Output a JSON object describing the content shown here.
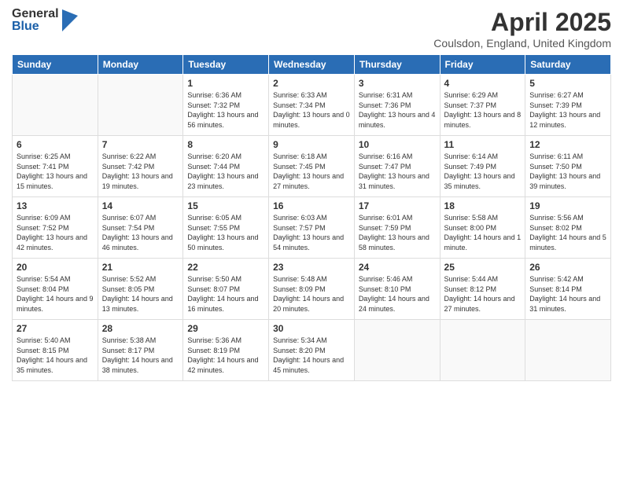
{
  "logo": {
    "general": "General",
    "blue": "Blue"
  },
  "title": "April 2025",
  "subtitle": "Coulsdon, England, United Kingdom",
  "headers": [
    "Sunday",
    "Monday",
    "Tuesday",
    "Wednesday",
    "Thursday",
    "Friday",
    "Saturday"
  ],
  "weeks": [
    [
      {
        "day": "",
        "sunrise": "",
        "sunset": "",
        "daylight": "",
        "empty": true
      },
      {
        "day": "",
        "sunrise": "",
        "sunset": "",
        "daylight": "",
        "empty": true
      },
      {
        "day": "1",
        "sunrise": "Sunrise: 6:36 AM",
        "sunset": "Sunset: 7:32 PM",
        "daylight": "Daylight: 13 hours and 56 minutes.",
        "empty": false
      },
      {
        "day": "2",
        "sunrise": "Sunrise: 6:33 AM",
        "sunset": "Sunset: 7:34 PM",
        "daylight": "Daylight: 13 hours and 0 minutes.",
        "empty": false
      },
      {
        "day": "3",
        "sunrise": "Sunrise: 6:31 AM",
        "sunset": "Sunset: 7:36 PM",
        "daylight": "Daylight: 13 hours and 4 minutes.",
        "empty": false
      },
      {
        "day": "4",
        "sunrise": "Sunrise: 6:29 AM",
        "sunset": "Sunset: 7:37 PM",
        "daylight": "Daylight: 13 hours and 8 minutes.",
        "empty": false
      },
      {
        "day": "5",
        "sunrise": "Sunrise: 6:27 AM",
        "sunset": "Sunset: 7:39 PM",
        "daylight": "Daylight: 13 hours and 12 minutes.",
        "empty": false
      }
    ],
    [
      {
        "day": "6",
        "sunrise": "Sunrise: 6:25 AM",
        "sunset": "Sunset: 7:41 PM",
        "daylight": "Daylight: 13 hours and 15 minutes.",
        "empty": false
      },
      {
        "day": "7",
        "sunrise": "Sunrise: 6:22 AM",
        "sunset": "Sunset: 7:42 PM",
        "daylight": "Daylight: 13 hours and 19 minutes.",
        "empty": false
      },
      {
        "day": "8",
        "sunrise": "Sunrise: 6:20 AM",
        "sunset": "Sunset: 7:44 PM",
        "daylight": "Daylight: 13 hours and 23 minutes.",
        "empty": false
      },
      {
        "day": "9",
        "sunrise": "Sunrise: 6:18 AM",
        "sunset": "Sunset: 7:45 PM",
        "daylight": "Daylight: 13 hours and 27 minutes.",
        "empty": false
      },
      {
        "day": "10",
        "sunrise": "Sunrise: 6:16 AM",
        "sunset": "Sunset: 7:47 PM",
        "daylight": "Daylight: 13 hours and 31 minutes.",
        "empty": false
      },
      {
        "day": "11",
        "sunrise": "Sunrise: 6:14 AM",
        "sunset": "Sunset: 7:49 PM",
        "daylight": "Daylight: 13 hours and 35 minutes.",
        "empty": false
      },
      {
        "day": "12",
        "sunrise": "Sunrise: 6:11 AM",
        "sunset": "Sunset: 7:50 PM",
        "daylight": "Daylight: 13 hours and 39 minutes.",
        "empty": false
      }
    ],
    [
      {
        "day": "13",
        "sunrise": "Sunrise: 6:09 AM",
        "sunset": "Sunset: 7:52 PM",
        "daylight": "Daylight: 13 hours and 42 minutes.",
        "empty": false
      },
      {
        "day": "14",
        "sunrise": "Sunrise: 6:07 AM",
        "sunset": "Sunset: 7:54 PM",
        "daylight": "Daylight: 13 hours and 46 minutes.",
        "empty": false
      },
      {
        "day": "15",
        "sunrise": "Sunrise: 6:05 AM",
        "sunset": "Sunset: 7:55 PM",
        "daylight": "Daylight: 13 hours and 50 minutes.",
        "empty": false
      },
      {
        "day": "16",
        "sunrise": "Sunrise: 6:03 AM",
        "sunset": "Sunset: 7:57 PM",
        "daylight": "Daylight: 13 hours and 54 minutes.",
        "empty": false
      },
      {
        "day": "17",
        "sunrise": "Sunrise: 6:01 AM",
        "sunset": "Sunset: 7:59 PM",
        "daylight": "Daylight: 13 hours and 58 minutes.",
        "empty": false
      },
      {
        "day": "18",
        "sunrise": "Sunrise: 5:58 AM",
        "sunset": "Sunset: 8:00 PM",
        "daylight": "Daylight: 14 hours and 1 minute.",
        "empty": false
      },
      {
        "day": "19",
        "sunrise": "Sunrise: 5:56 AM",
        "sunset": "Sunset: 8:02 PM",
        "daylight": "Daylight: 14 hours and 5 minutes.",
        "empty": false
      }
    ],
    [
      {
        "day": "20",
        "sunrise": "Sunrise: 5:54 AM",
        "sunset": "Sunset: 8:04 PM",
        "daylight": "Daylight: 14 hours and 9 minutes.",
        "empty": false
      },
      {
        "day": "21",
        "sunrise": "Sunrise: 5:52 AM",
        "sunset": "Sunset: 8:05 PM",
        "daylight": "Daylight: 14 hours and 13 minutes.",
        "empty": false
      },
      {
        "day": "22",
        "sunrise": "Sunrise: 5:50 AM",
        "sunset": "Sunset: 8:07 PM",
        "daylight": "Daylight: 14 hours and 16 minutes.",
        "empty": false
      },
      {
        "day": "23",
        "sunrise": "Sunrise: 5:48 AM",
        "sunset": "Sunset: 8:09 PM",
        "daylight": "Daylight: 14 hours and 20 minutes.",
        "empty": false
      },
      {
        "day": "24",
        "sunrise": "Sunrise: 5:46 AM",
        "sunset": "Sunset: 8:10 PM",
        "daylight": "Daylight: 14 hours and 24 minutes.",
        "empty": false
      },
      {
        "day": "25",
        "sunrise": "Sunrise: 5:44 AM",
        "sunset": "Sunset: 8:12 PM",
        "daylight": "Daylight: 14 hours and 27 minutes.",
        "empty": false
      },
      {
        "day": "26",
        "sunrise": "Sunrise: 5:42 AM",
        "sunset": "Sunset: 8:14 PM",
        "daylight": "Daylight: 14 hours and 31 minutes.",
        "empty": false
      }
    ],
    [
      {
        "day": "27",
        "sunrise": "Sunrise: 5:40 AM",
        "sunset": "Sunset: 8:15 PM",
        "daylight": "Daylight: 14 hours and 35 minutes.",
        "empty": false
      },
      {
        "day": "28",
        "sunrise": "Sunrise: 5:38 AM",
        "sunset": "Sunset: 8:17 PM",
        "daylight": "Daylight: 14 hours and 38 minutes.",
        "empty": false
      },
      {
        "day": "29",
        "sunrise": "Sunrise: 5:36 AM",
        "sunset": "Sunset: 8:19 PM",
        "daylight": "Daylight: 14 hours and 42 minutes.",
        "empty": false
      },
      {
        "day": "30",
        "sunrise": "Sunrise: 5:34 AM",
        "sunset": "Sunset: 8:20 PM",
        "daylight": "Daylight: 14 hours and 45 minutes.",
        "empty": false
      },
      {
        "day": "",
        "sunrise": "",
        "sunset": "",
        "daylight": "",
        "empty": true
      },
      {
        "day": "",
        "sunrise": "",
        "sunset": "",
        "daylight": "",
        "empty": true
      },
      {
        "day": "",
        "sunrise": "",
        "sunset": "",
        "daylight": "",
        "empty": true
      }
    ]
  ]
}
